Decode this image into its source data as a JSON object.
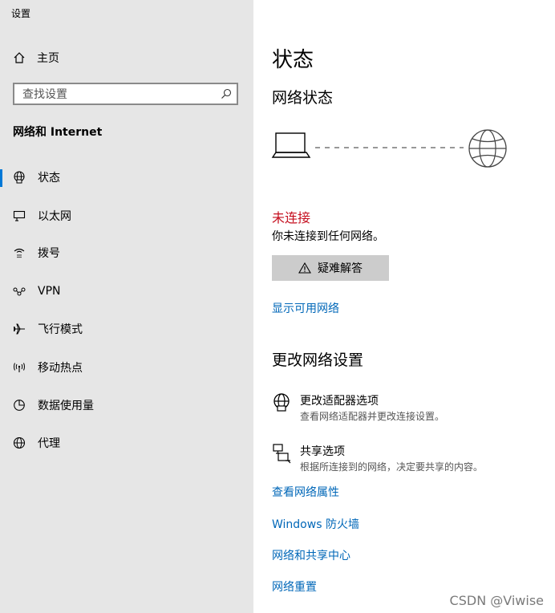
{
  "app": {
    "title": "设置"
  },
  "sidebar": {
    "home_label": "主页",
    "search_placeholder": "查找设置",
    "section_title": "网络和 Internet",
    "items": [
      {
        "label": "状态",
        "icon": "globe-network-icon",
        "active": true
      },
      {
        "label": "以太网",
        "icon": "ethernet-icon",
        "active": false
      },
      {
        "label": "拨号",
        "icon": "dialup-icon",
        "active": false
      },
      {
        "label": "VPN",
        "icon": "vpn-icon",
        "active": false
      },
      {
        "label": "飞行模式",
        "icon": "airplane-icon",
        "active": false
      },
      {
        "label": "移动热点",
        "icon": "hotspot-icon",
        "active": false
      },
      {
        "label": "数据使用量",
        "icon": "data-usage-icon",
        "active": false
      },
      {
        "label": "代理",
        "icon": "globe-icon",
        "active": false
      }
    ]
  },
  "main": {
    "page_title": "状态",
    "network_status_title": "网络状态",
    "connection_state": "未连接",
    "connection_desc": "你未连接到任何网络。",
    "troubleshoot_label": "疑难解答",
    "show_networks_link": "显示可用网络",
    "change_settings_title": "更改网络设置",
    "options": [
      {
        "title": "更改适配器选项",
        "subtitle": "查看网络适配器并更改连接设置。",
        "icon": "adapter-globe-icon"
      },
      {
        "title": "共享选项",
        "subtitle": "根据所连接到的网络，决定要共享的内容。",
        "icon": "sharing-icon"
      }
    ],
    "links": [
      "查看网络属性",
      "Windows 防火墙",
      "网络和共享中心",
      "网络重置"
    ]
  },
  "colors": {
    "sidebar_bg": "#e6e6e6",
    "accent": "#0078d7",
    "link": "#0067b8",
    "error": "#c50f1f",
    "button_bg": "#cccccc"
  },
  "watermark": "CSDN @Viwise"
}
